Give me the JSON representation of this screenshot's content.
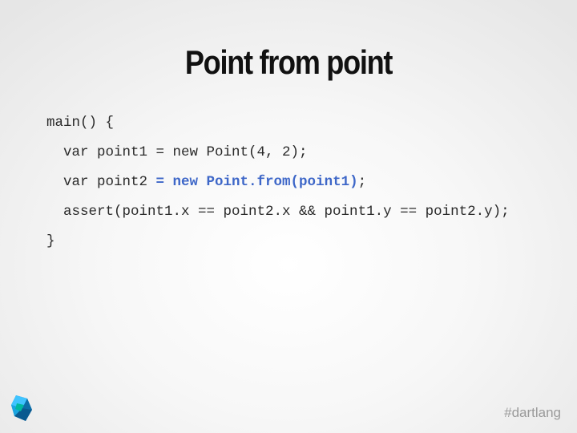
{
  "slide": {
    "title": "Point from point",
    "code": {
      "line1": "main() {",
      "line2": "  var point1 = new Point(4, 2);",
      "line3_pre": "  var point2 ",
      "line3_highlight": "= new Point.from(point1)",
      "line3_post": ";",
      "line4": "  assert(point1.x == point2.x && point1.y == point2.y);",
      "line5": "}"
    },
    "highlight_color": "#3e67c8",
    "logo_icon": "dart-logo-icon",
    "hashtag": "#dartlang"
  }
}
